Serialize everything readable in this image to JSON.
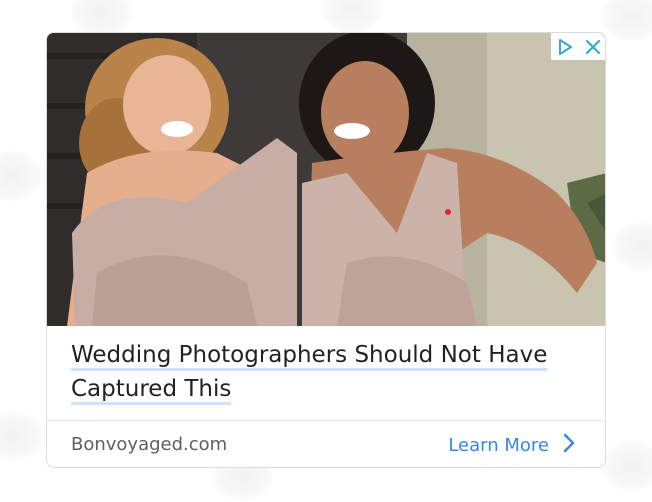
{
  "ad": {
    "headline": "Wedding Photographers Should Not Have Captured This",
    "headline_line1": "Wedding Photographers Should Not Have",
    "headline_line2": "Captured This",
    "advertiser": "Bonvoyaged.com",
    "cta_label": "Learn More",
    "badge": {
      "info_icon": "adchoices-play-icon",
      "close_icon": "close-x-icon"
    }
  },
  "colors": {
    "cta": "#3a86e0",
    "headline": "#222222",
    "advertiser": "#606060",
    "underline": "#cfe2f7",
    "badge_icon": "#35a8d8"
  }
}
